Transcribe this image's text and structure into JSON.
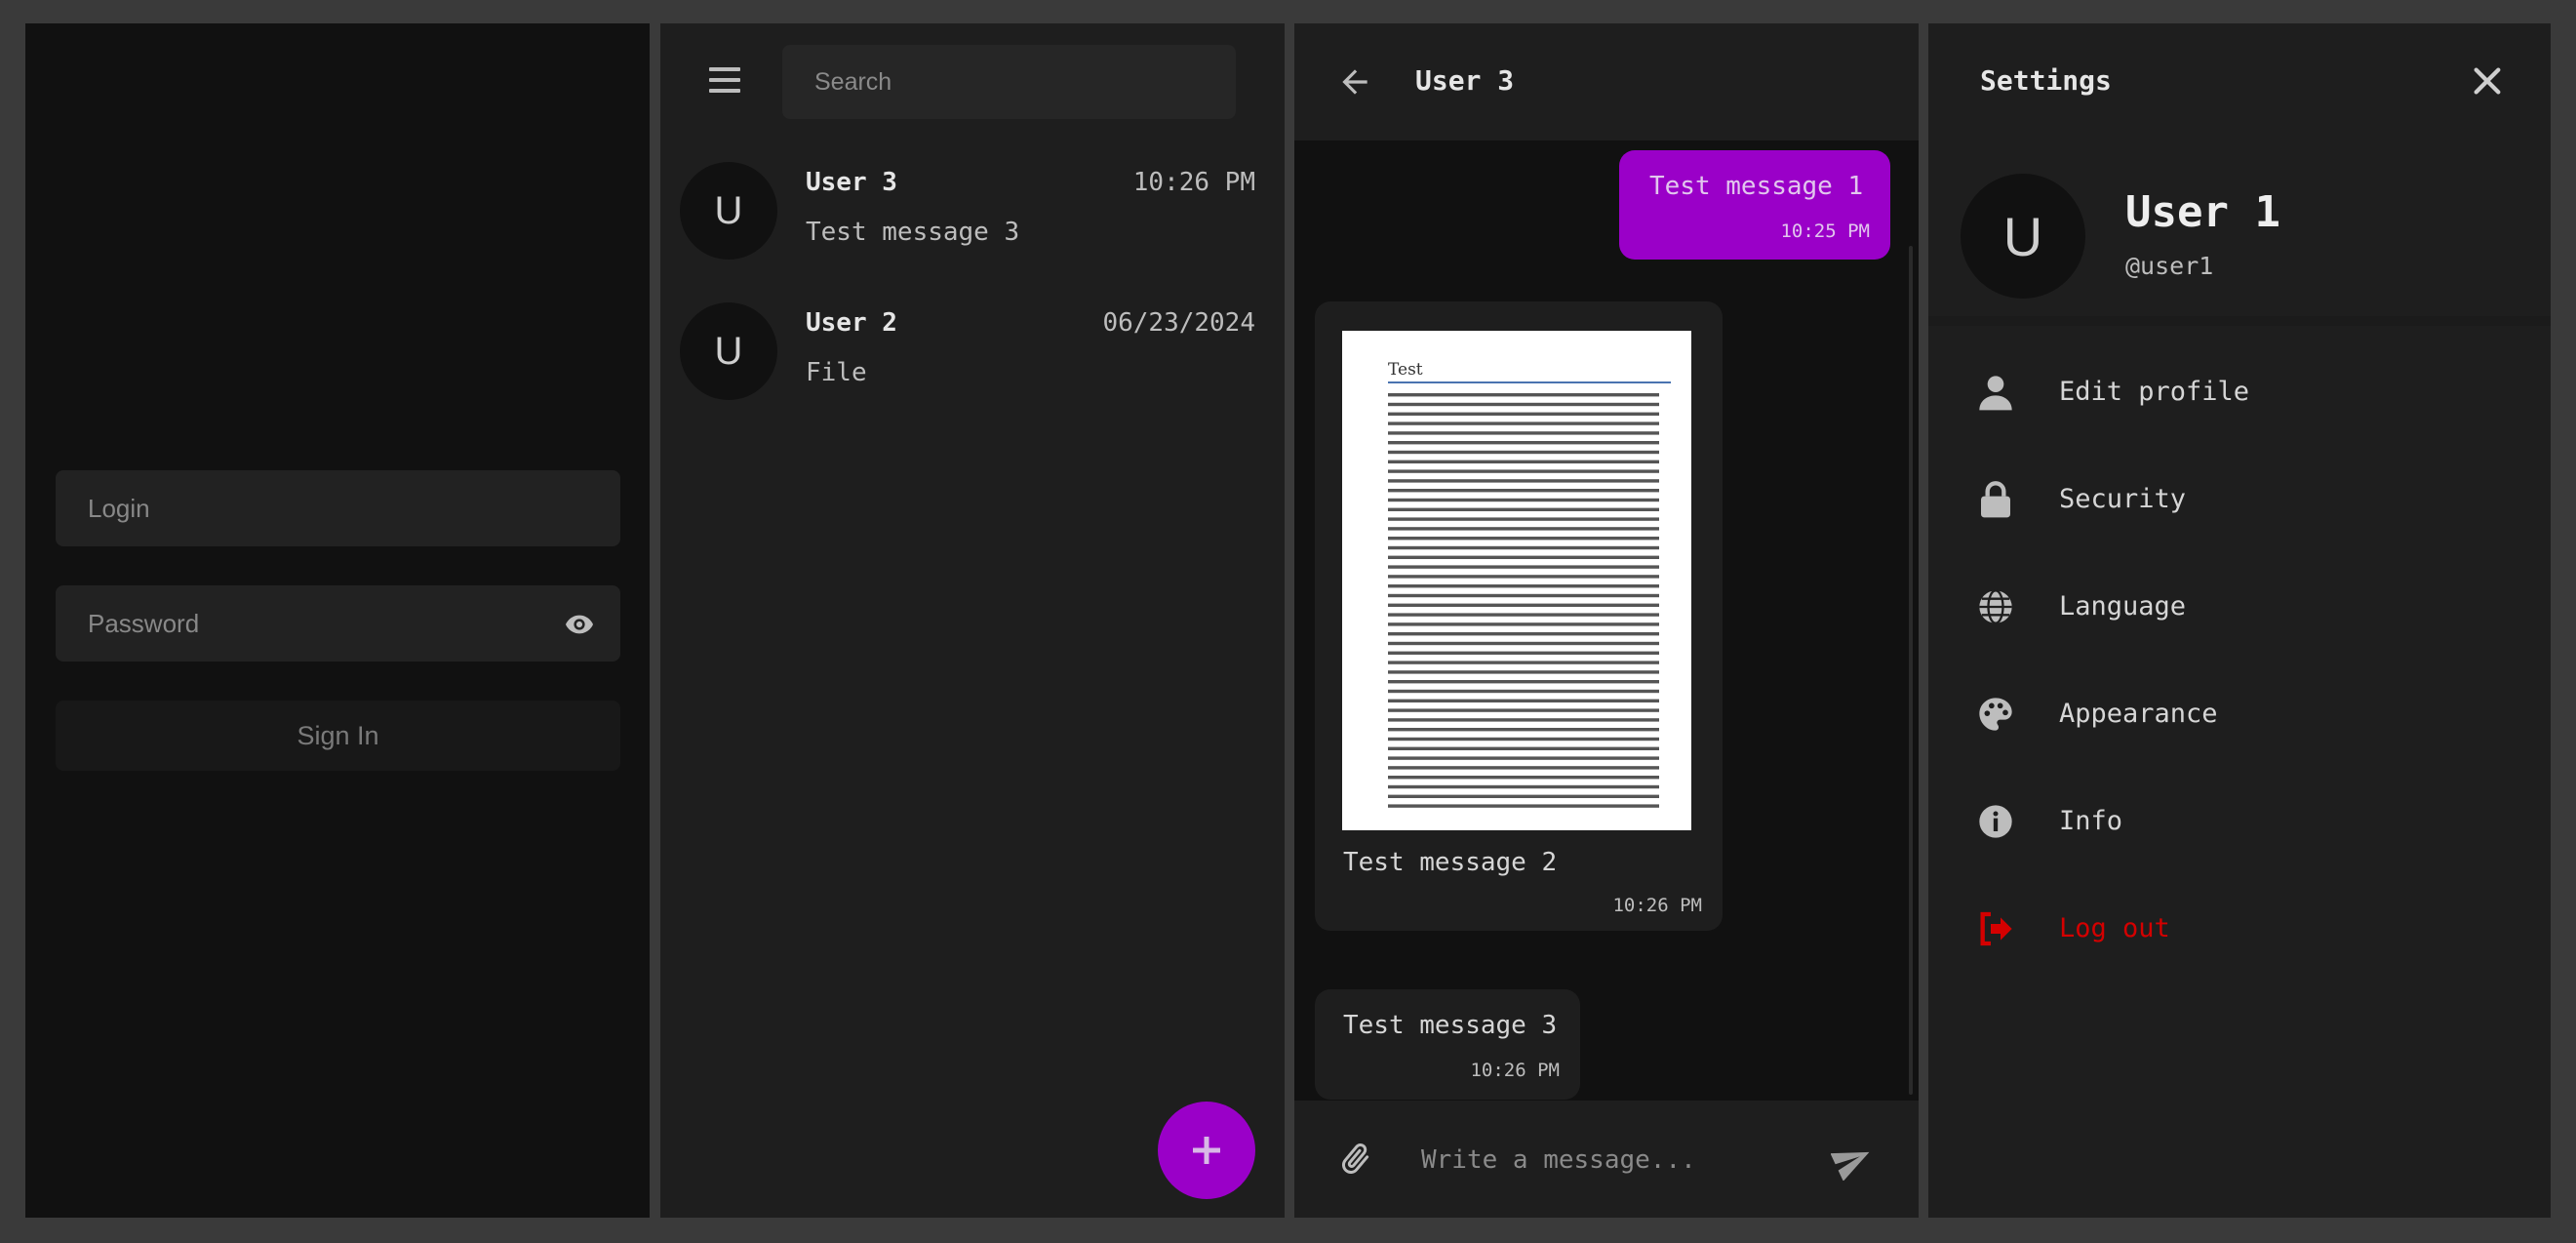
{
  "login": {
    "login_placeholder": "Login",
    "password_placeholder": "Password",
    "sign_in_label": "Sign In",
    "password_toggle_icon": "eye-icon"
  },
  "chat_list": {
    "search_placeholder": "Search",
    "menu_icon": "hamburger-icon",
    "chats": [
      {
        "avatar": "U",
        "name": "User 3",
        "time": "10:26 PM",
        "preview": "Test message 3"
      },
      {
        "avatar": "U",
        "name": "User 2",
        "time": "06/23/2024",
        "preview": "File"
      }
    ],
    "fab_icon": "plus-icon"
  },
  "chat": {
    "title": "User 3",
    "messages": [
      {
        "text": "Test message 1",
        "time": "10:25 PM",
        "outgoing": true
      },
      {
        "text": "Test message 2",
        "time": "10:26 PM",
        "outgoing": false,
        "attachment_title": "Test"
      },
      {
        "text": "Test message 3",
        "time": "10:26 PM",
        "outgoing": false
      }
    ],
    "input_placeholder": "Write a message..."
  },
  "settings": {
    "title": "Settings",
    "profile": {
      "avatar": "U",
      "name": "User 1",
      "username": "@user1"
    },
    "menu": [
      {
        "label": "Edit profile",
        "icon": "person-icon"
      },
      {
        "label": "Security",
        "icon": "lock-icon"
      },
      {
        "label": "Language",
        "icon": "globe-icon"
      },
      {
        "label": "Appearance",
        "icon": "palette-icon"
      },
      {
        "label": "Info",
        "icon": "info-icon"
      },
      {
        "label": "Log out",
        "icon": "logout-icon"
      }
    ]
  },
  "colors": {
    "accent": "#9a00c8",
    "danger": "#d40000",
    "background": "#3a3a3a",
    "panel_dark": "#111111",
    "panel": "#1e1e1e"
  }
}
